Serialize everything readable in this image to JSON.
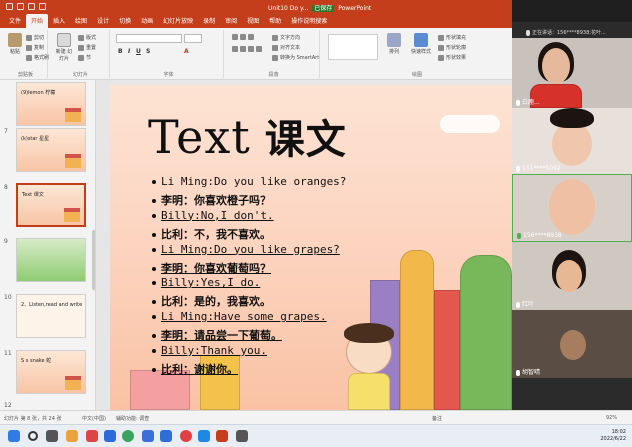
{
  "titlebar": {
    "document": "Unit10 Do y...",
    "saved_badge": "已保存",
    "app": "PowerPoint",
    "search": "操作说明搜索"
  },
  "tabs": [
    "文件",
    "开始",
    "插入",
    "绘图",
    "设计",
    "切换",
    "动画",
    "幻灯片放映",
    "录制",
    "审阅",
    "视图",
    "帮助",
    "操作说明搜索"
  ],
  "ribbon": {
    "paste": "粘贴",
    "cut": "剪切",
    "copy": "复制",
    "format_painter": "格式刷",
    "new_slide": "新建\n幻灯片",
    "layout": "版式",
    "reset": "重置",
    "section": "节",
    "clipboard_group": "剪贴板",
    "slides_group": "幻灯片",
    "font_group": "字体",
    "paragraph_group": "段落",
    "drawing_group": "绘图",
    "text_direction": "文字方向",
    "align_text": "对齐文本",
    "smartart": "转换为 SmartArt",
    "arrange": "排列",
    "quick_styles": "快速样式",
    "shape_fill": "形状填充",
    "shape_outline": "形状轮廓",
    "shape_effects": "形状效果"
  },
  "thumbnails": [
    {
      "num": "",
      "text": "(9)lemon  柠檬"
    },
    {
      "num": "7",
      "text": "(k)star  星星"
    },
    {
      "num": "8",
      "text": "Text 课文"
    },
    {
      "num": "9",
      "text": ""
    },
    {
      "num": "10",
      "text": "2、Listen,read and write"
    },
    {
      "num": "11",
      "text": "S s  snake 蛇"
    },
    {
      "num": "12",
      "text": ""
    }
  ],
  "slide": {
    "title_en": "Text",
    "title_cn": "课文",
    "lines": [
      {
        "text": "Li Ming:Do you like oranges?",
        "kind": "en",
        "ul": false
      },
      {
        "text": "李明：你喜欢橙子吗？",
        "kind": "cn",
        "ul": false
      },
      {
        "text": "Billy:No,I don't.",
        "kind": "en",
        "ul": true
      },
      {
        "text": "比利：不，我不喜欢。",
        "kind": "cn",
        "ul": false
      },
      {
        "text": "Li Ming:Do you like grapes?",
        "kind": "en",
        "ul": true
      },
      {
        "text": "李明：你喜欢葡萄吗？",
        "kind": "cn",
        "ul": true
      },
      {
        "text": "Billy:Yes,I do.",
        "kind": "en",
        "ul": true
      },
      {
        "text": "比利：是的，我喜欢。",
        "kind": "cn",
        "ul": false
      },
      {
        "text": "Li Ming:Have some grapes.",
        "kind": "en",
        "ul": true
      },
      {
        "text": "李明：请品尝一下葡萄。",
        "kind": "cn",
        "ul": true
      },
      {
        "text": "Billy:Thank you.",
        "kind": "en",
        "ul": true
      },
      {
        "text": "比利：谢谢你。",
        "kind": "cn",
        "ul": true
      }
    ]
  },
  "meeting": {
    "speaking": "正在讲话：156****8938;花叶...",
    "participants": [
      {
        "name": "白鹿..."
      },
      {
        "name": "151****5092"
      },
      {
        "name": "156****8938"
      },
      {
        "name": "红叶"
      },
      {
        "name": "胡智晴"
      }
    ]
  },
  "statusbar": {
    "slide_info": "幻灯片 第 8 张，共 24 张",
    "language": "中文(中国)",
    "accessibility": "辅助功能: 调查",
    "notes": "备注",
    "zoom": "92%"
  },
  "clock": {
    "time": "18:02",
    "date": "2022/6/22"
  }
}
